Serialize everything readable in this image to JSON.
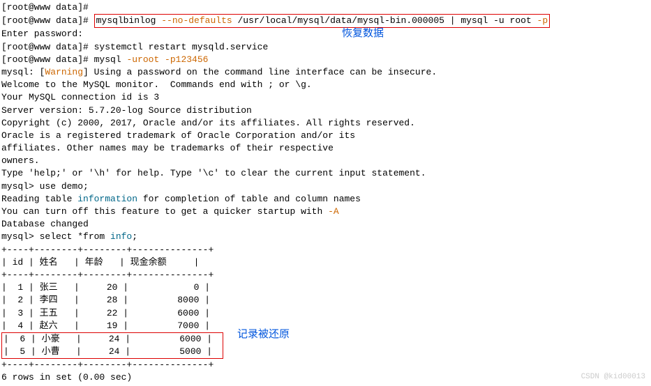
{
  "lines": {
    "l0": "[root@www data]# ",
    "l1_prompt": "[root@www data]# ",
    "l1_cmd": "mysqlbinlog ",
    "l1_flag": "--no-defaults",
    "l1_path": " /usr/local/mysql/data/mysql-bin.000005 | mysql -u root ",
    "l1_p": "-p",
    "l2": "Enter password:",
    "l3": "[root@www data]# systemctl restart mysqld.service",
    "l4_a": "[root@www data]# mysql ",
    "l4_b": "-uroot -p123456",
    "l5_a": "mysql: [",
    "l5_b": "Warning",
    "l5_c": "] Using a password on the command line interface can be insecure.",
    "l6": "Welcome to the MySQL monitor.  Commands end with ; or \\g.",
    "l7": "Your MySQL connection id is 3",
    "l8": "Server version: 5.7.20-log Source distribution",
    "l9": "",
    "l10": "Copyright (c) 2000, 2017, Oracle and/or its affiliates. All rights reserved.",
    "l11": "",
    "l12": "Oracle is a registered trademark of Oracle Corporation and/or its",
    "l13": "affiliates. Other names may be trademarks of their respective",
    "l14": "owners.",
    "l15": "",
    "l16": "Type 'help;' or '\\h' for help. Type '\\c' to clear the current input statement.",
    "l17": "",
    "l18": "mysql> use demo;",
    "l19_a": "Reading table ",
    "l19_b": "information",
    "l19_c": " for completion of table and column names",
    "l20_a": "You can turn off this feature to get a quicker startup with ",
    "l20_b": "-A",
    "l21": "",
    "l22": "Database changed",
    "l23_a": "mysql> select *from ",
    "l23_b": "info",
    "l23_c": ";",
    "sep": "+----+--------+--------+--------------+",
    "hdr": "| id | 姓名   | 年龄   | 现金余额     |",
    "r1": "|  1 | 张三   |     20 |            0 |",
    "r2": "|  2 | 李四   |     28 |         8000 |",
    "r3": "|  3 | 王五   |     22 |         6000 |",
    "r4": "|  4 | 赵六   |     19 |         7000 |",
    "r5": "|  6 | 小豪   |     24 |         6000 |",
    "r6": "|  5 | 小曹   |     24 |         5000 |",
    "foot": "6 rows in set (0.00 sec)"
  },
  "annotations": {
    "a1": "恢复数据",
    "a2": "记录被还原"
  },
  "watermark": "CSDN @kid00013"
}
